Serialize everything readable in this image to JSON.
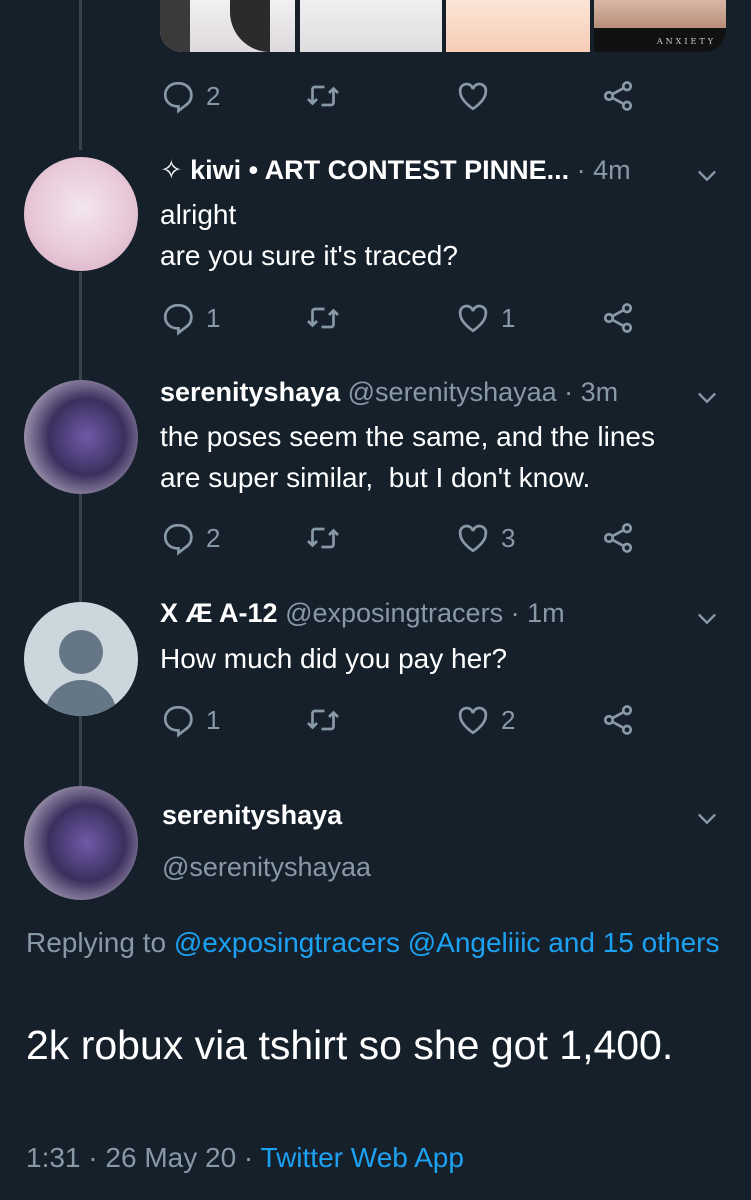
{
  "top_tweet": {
    "reply_count": "2",
    "retweet_count": "",
    "like_count": "",
    "media_logo_text": "ANXIETY"
  },
  "replies": [
    {
      "name": "✧ kiwi • ART CONTEST PINNE...",
      "handle": "",
      "time": "· 4m",
      "text": [
        "alright",
        "are you sure it's traced?"
      ],
      "reply_count": "1",
      "retweet_count": "",
      "like_count": "1",
      "avatar": "kiwi-avatar"
    },
    {
      "name": "serenityshaya",
      "handle": "@serenityshayaa",
      "time": "· 3m",
      "text": [
        "the poses seem the same, and the lines",
        "are super similar,  but I don't know."
      ],
      "reply_count": "2",
      "retweet_count": "",
      "like_count": "3",
      "avatar": "serenityshaya-avatar"
    },
    {
      "name": "X Æ A-12",
      "handle": "@exposingtracers",
      "time": "· 1m",
      "text": [
        "How much did you pay her?"
      ],
      "reply_count": "1",
      "retweet_count": "",
      "like_count": "2",
      "avatar": "default-avatar"
    }
  ],
  "focused_tweet": {
    "name": "serenityshaya",
    "handle": "@serenityshayaa",
    "replying_prefix": "Replying to",
    "replying_links": [
      "@exposingtracers",
      "@Angeliiic",
      "and 15 others"
    ],
    "text": "2k robux via tshirt so she got 1,400.",
    "time": "1:31",
    "date": "26 May 20",
    "source": "Twitter Web App",
    "separator": "·"
  },
  "colors": {
    "background": "#15202b",
    "secondary_text": "#8899a6",
    "link": "#1da1f2",
    "thread_line": "#38444d"
  }
}
